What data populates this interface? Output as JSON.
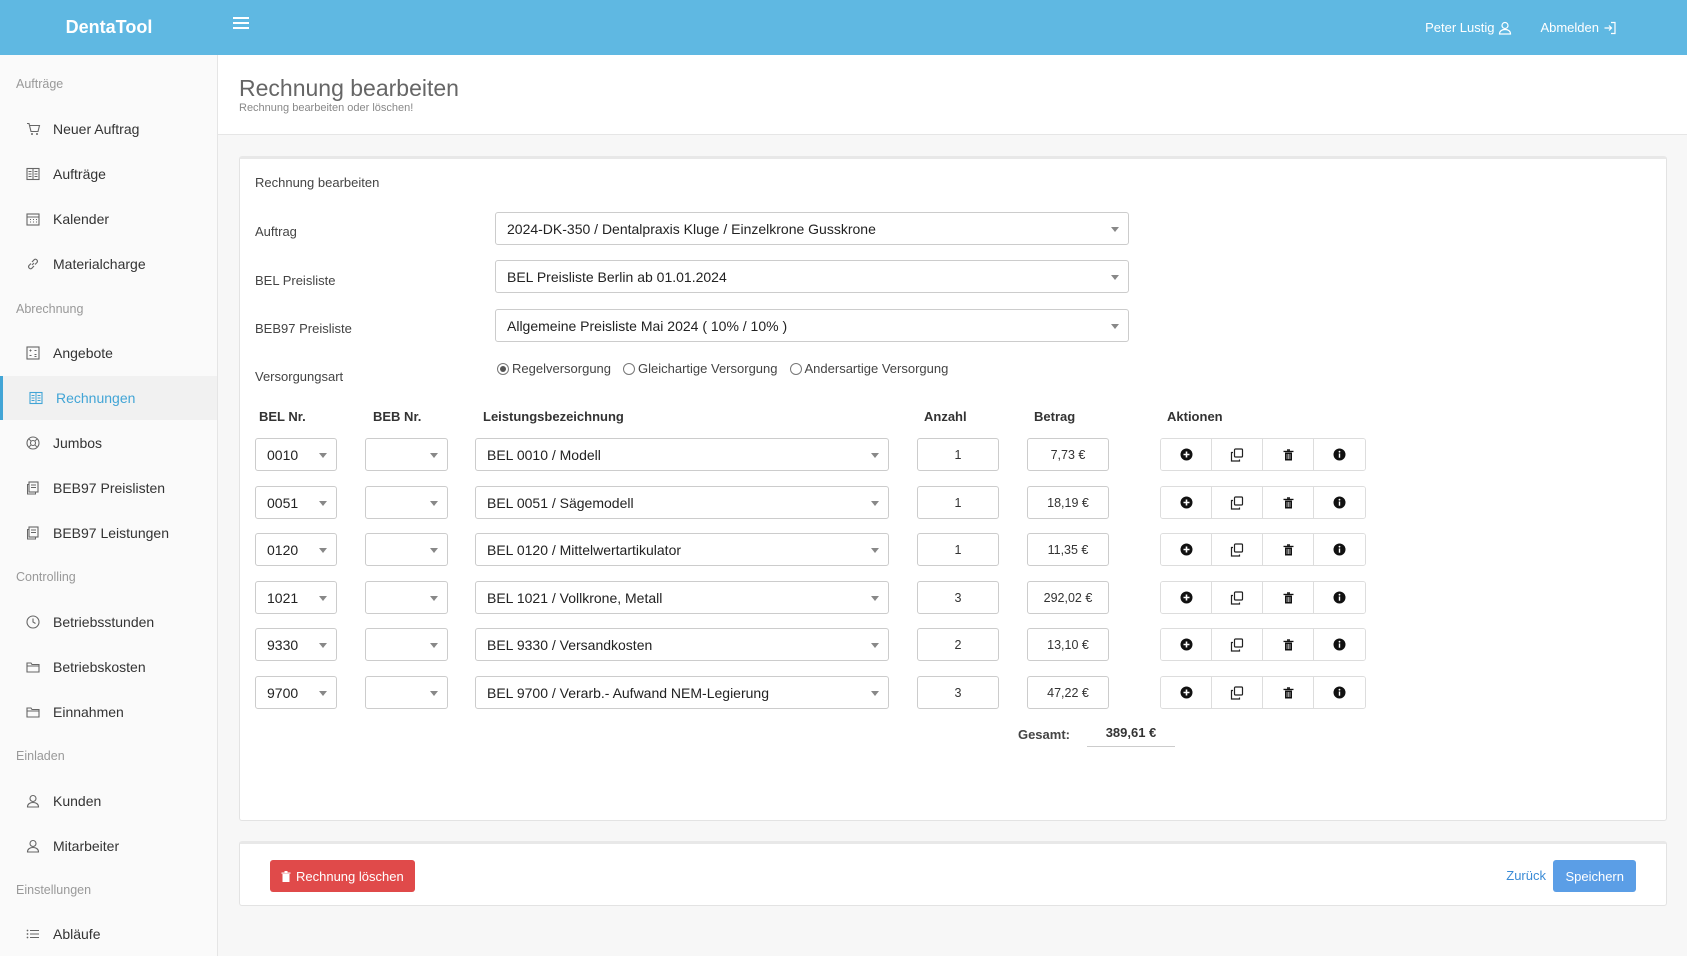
{
  "app": {
    "name": "DentaTool"
  },
  "topbar": {
    "user": "Peter Lustig",
    "logout": "Abmelden"
  },
  "sidebar": {
    "sections": [
      {
        "title": "Aufträge"
      },
      {
        "title": "Abrechnung"
      },
      {
        "title": "Controlling"
      },
      {
        "title": "Einladen"
      },
      {
        "title": "Einstellungen"
      }
    ],
    "items": [
      {
        "label": "Neuer Auftrag",
        "icon": "cart-icon"
      },
      {
        "label": "Aufträge",
        "icon": "list-icon"
      },
      {
        "label": "Kalender",
        "icon": "calendar-icon"
      },
      {
        "label": "Materialcharge",
        "icon": "link-icon"
      },
      {
        "label": "Angebote",
        "icon": "calculator-icon"
      },
      {
        "label": "Rechnungen",
        "icon": "invoice-icon",
        "active": true
      },
      {
        "label": "Jumbos",
        "icon": "support-icon"
      },
      {
        "label": "BEB97 Preislisten",
        "icon": "documents-icon"
      },
      {
        "label": "BEB97 Leistungen",
        "icon": "documents-icon"
      },
      {
        "label": "Betriebsstunden",
        "icon": "clock-icon"
      },
      {
        "label": "Betriebskosten",
        "icon": "folder-icon"
      },
      {
        "label": "Einnahmen",
        "icon": "folder-icon"
      },
      {
        "label": "Kunden",
        "icon": "user-icon"
      },
      {
        "label": "Mitarbeiter",
        "icon": "user-icon"
      },
      {
        "label": "Abläufe",
        "icon": "list-bullets-icon"
      }
    ]
  },
  "page": {
    "title": "Rechnung bearbeiten",
    "subtitle": "Rechnung bearbeiten oder löschen!"
  },
  "form": {
    "card_title": "Rechnung bearbeiten",
    "auftrag": {
      "label": "Auftrag",
      "value": "2024-DK-350 / Dentalpraxis Kluge / Einzelkrone Gusskrone"
    },
    "bel_preisliste": {
      "label": "BEL Preisliste",
      "value": "BEL Preisliste Berlin ab 01.01.2024"
    },
    "beb97_preisliste": {
      "label": "BEB97 Preisliste",
      "value": "Allgemeine Preisliste Mai 2024 ( 10% / 10% )"
    },
    "versorgungsart": {
      "label": "Versorgungsart",
      "options": [
        "Regelversorgung",
        "Gleichartige Versorgung",
        "Andersartige Versorgung"
      ],
      "selected": "Regelversorgung"
    }
  },
  "table": {
    "headers": {
      "bel": "BEL Nr.",
      "beb": "BEB Nr.",
      "leistung": "Leistungsbezeichnung",
      "anzahl": "Anzahl",
      "betrag": "Betrag",
      "aktionen": "Aktionen"
    },
    "rows": [
      {
        "bel": "0010",
        "beb": "",
        "leistung": "BEL 0010 / Modell",
        "anzahl": "1",
        "betrag": "7,73 €"
      },
      {
        "bel": "0051",
        "beb": "",
        "leistung": "BEL 0051 / Sägemodell",
        "anzahl": "1",
        "betrag": "18,19 €"
      },
      {
        "bel": "0120",
        "beb": "",
        "leistung": "BEL 0120 / Mittelwertartikulator",
        "anzahl": "1",
        "betrag": "11,35 €"
      },
      {
        "bel": "1021",
        "beb": "",
        "leistung": "BEL 1021 / Vollkrone, Metall",
        "anzahl": "3",
        "betrag": "292,02 €"
      },
      {
        "bel": "9330",
        "beb": "",
        "leistung": "BEL 9330 / Versandkosten",
        "anzahl": "2",
        "betrag": "13,10 €"
      },
      {
        "bel": "9700",
        "beb": "",
        "leistung": "BEL 9700 / Verarb.- Aufwand NEM-Legierung",
        "anzahl": "3",
        "betrag": "47,22 €"
      }
    ],
    "total_label": "Gesamt:",
    "total_value": "389,61 €"
  },
  "footer": {
    "delete": "Rechnung löschen",
    "back": "Zurück",
    "save": "Speichern"
  }
}
